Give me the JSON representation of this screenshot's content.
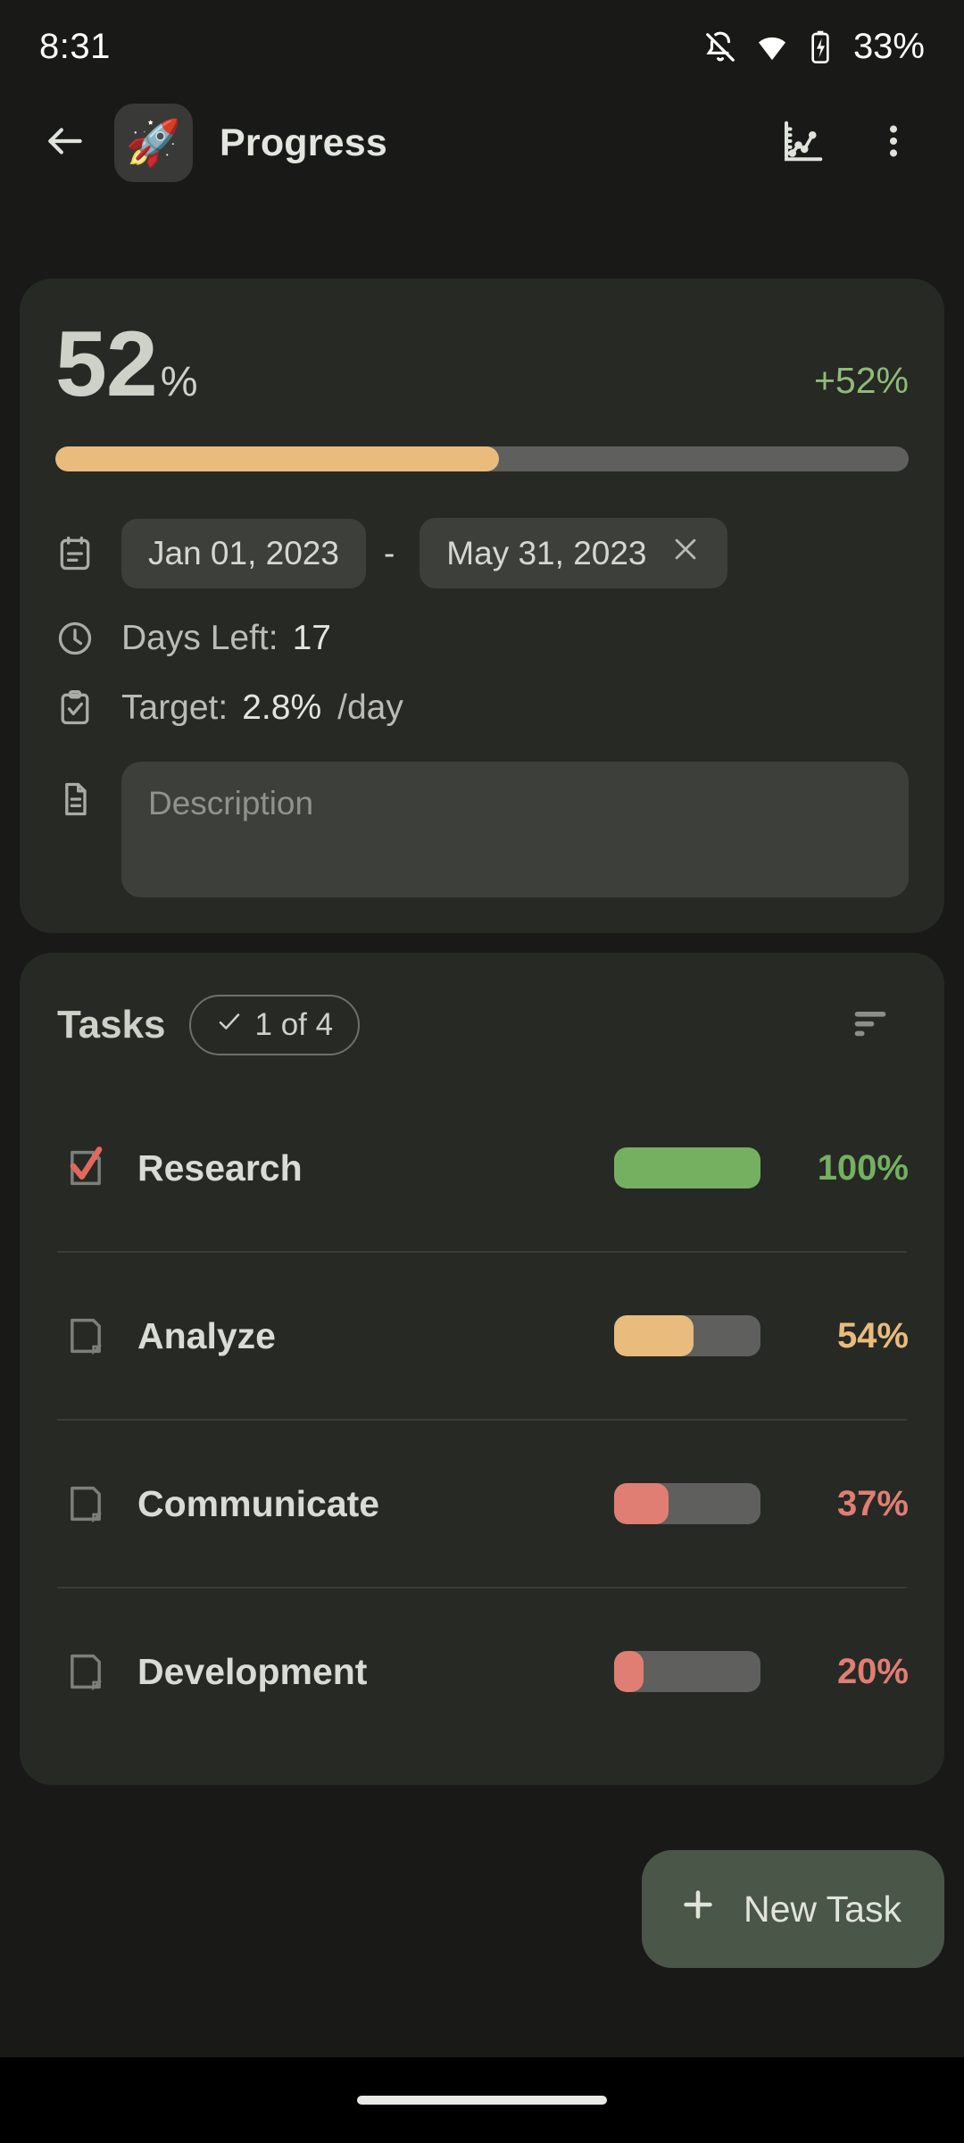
{
  "status_bar": {
    "time": "8:31",
    "battery_text": "33%",
    "icons": [
      "notifications-off-icon",
      "wifi-icon",
      "battery-charging-icon"
    ]
  },
  "app_bar": {
    "back_icon": "arrow-back-icon",
    "app_emoji": "🚀",
    "title": "Progress",
    "chart_icon": "line-chart-icon",
    "overflow_icon": "more-vertical-icon"
  },
  "overview": {
    "percent_value": "52",
    "percent_sign": "%",
    "delta": "+52%",
    "progress_fill_percent": 52,
    "progress_fill_color": "#e9bb7d",
    "progress_track_color": "#5f5f5d",
    "delta_color": "#8fbb78",
    "calendar_icon": "calendar-icon",
    "start_date": "Jan 01, 2023",
    "date_separator": "-",
    "end_date": "May 31, 2023",
    "clear_date_icon": "close-icon",
    "clock_icon": "clock-icon",
    "days_left_label": "Days Left:",
    "days_left_value": "17",
    "target_icon": "clipboard-check-icon",
    "target_label": "Target:",
    "target_value": "2.8%",
    "target_suffix": "/day",
    "description_icon": "document-icon",
    "description_placeholder": "Description",
    "description_value": ""
  },
  "tasks": {
    "title": "Tasks",
    "count_check_icon": "check-icon",
    "count_label": "1 of 4",
    "sort_icon": "sort-icon",
    "items": [
      {
        "name": "Research",
        "checked": true,
        "percent": 100,
        "percent_label": "100%",
        "color": "#74b060",
        "checkbox_icon": "checkbox-checked-icon"
      },
      {
        "name": "Analyze",
        "checked": false,
        "percent": 54,
        "percent_label": "54%",
        "color": "#e9bb7d",
        "checkbox_icon": "checkbox-empty-icon"
      },
      {
        "name": "Communicate",
        "checked": false,
        "percent": 37,
        "percent_label": "37%",
        "color": "#e07e74",
        "checkbox_icon": "checkbox-empty-icon"
      },
      {
        "name": "Development",
        "checked": false,
        "percent": 20,
        "percent_label": "20%",
        "color": "#e07e74",
        "checkbox_icon": "checkbox-empty-icon"
      }
    ]
  },
  "fab": {
    "plus_icon": "plus-icon",
    "label": "New Task"
  },
  "nav_bar": {
    "handle": "home-indicator"
  }
}
